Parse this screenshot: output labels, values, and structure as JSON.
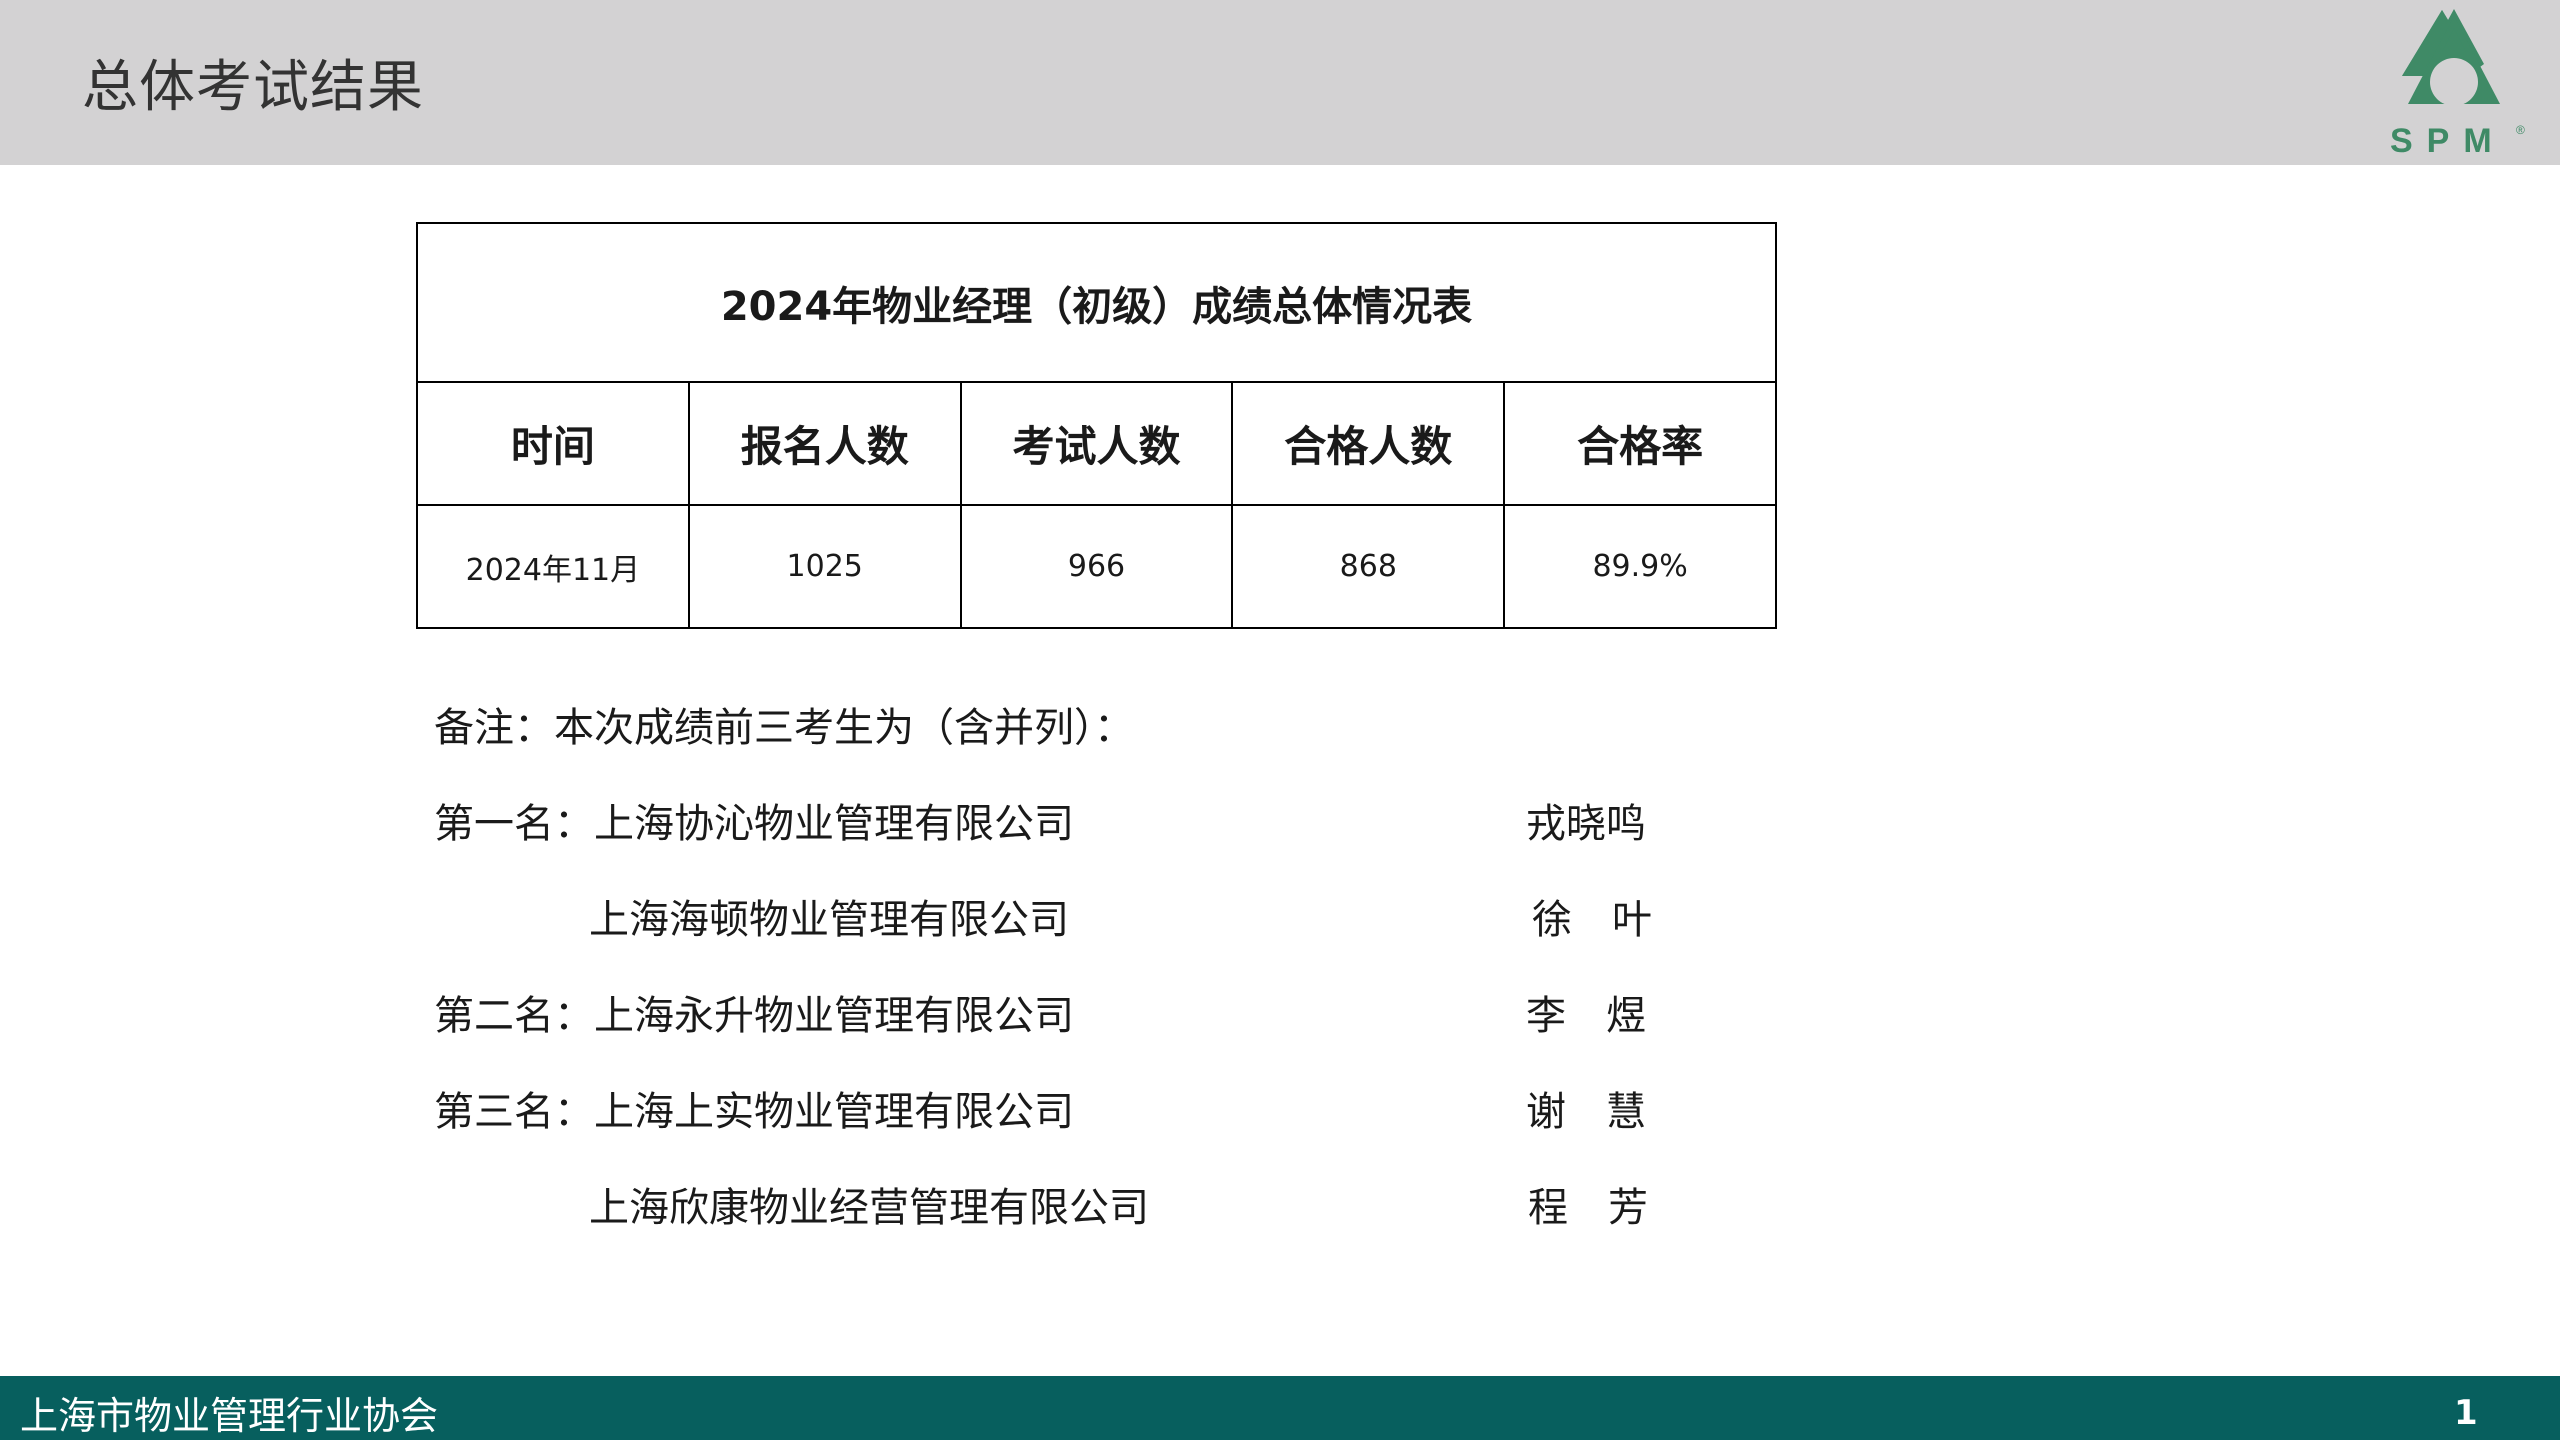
{
  "header": {
    "title": "总体考试结果",
    "logo_text": "SPM",
    "logo_mark": "®",
    "brand_color": "#3f8a66"
  },
  "table": {
    "caption": "2024年物业经理（初级）成绩总体情况表",
    "columns": [
      "时间",
      "报名人数",
      "考试人数",
      "合格人数",
      "合格率"
    ],
    "rows": [
      [
        "2024年11月",
        "1025",
        "966",
        "868",
        "89.9%"
      ]
    ]
  },
  "notes": {
    "intro": "备注：本次成绩前三考生为（含并列）：",
    "entries": [
      {
        "prefix": "第一名：",
        "company": "上海协沁物业管理有限公司",
        "name": "戎晓鸣"
      },
      {
        "prefix": "",
        "company": "上海海顿物业管理有限公司",
        "name": "徐　叶"
      },
      {
        "prefix": "第二名：",
        "company": "上海永升物业管理有限公司",
        "name": "李　煜"
      },
      {
        "prefix": "第三名：",
        "company": "上海上实物业管理有限公司",
        "name": "谢　慧"
      },
      {
        "prefix": "",
        "company": "上海欣康物业经营管理有限公司",
        "name": "程　芳"
      }
    ]
  },
  "footer": {
    "organization": "上海市物业管理行业协会",
    "page_number": "1",
    "color": "#075f5e"
  }
}
